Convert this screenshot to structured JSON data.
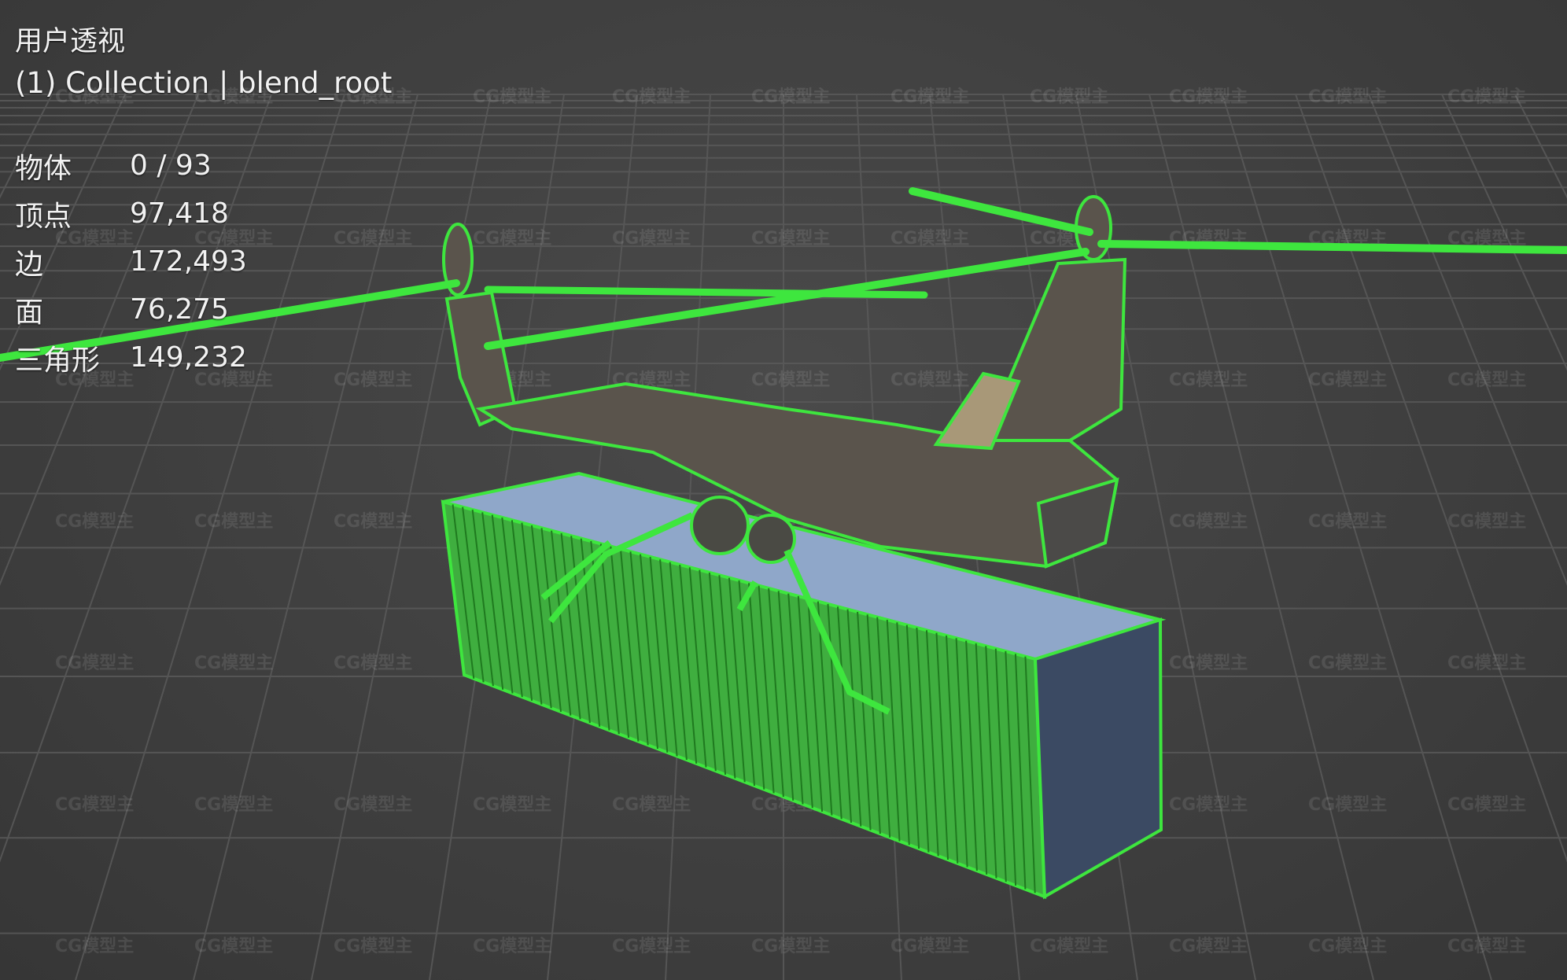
{
  "viewport": {
    "view_name": "用户透视",
    "collection_info": "(1) Collection | blend_root",
    "stats": [
      {
        "label": "物体",
        "value": "0 / 93"
      },
      {
        "label": "顶点",
        "value": "97,418"
      },
      {
        "label": "边",
        "value": "172,493"
      },
      {
        "label": "面",
        "value": "76,275"
      },
      {
        "label": "三角形",
        "value": "149,232"
      }
    ]
  },
  "watermark_text": "CG模型主",
  "colors": {
    "background": "#3d3d3d",
    "grid": "#5a5a5a",
    "wireframe": "#3ee63e",
    "container_body": "#3fb53f",
    "container_top": "#8fa7c9",
    "container_end": "#3b4a63",
    "helicopter_body": "#5a544c"
  }
}
